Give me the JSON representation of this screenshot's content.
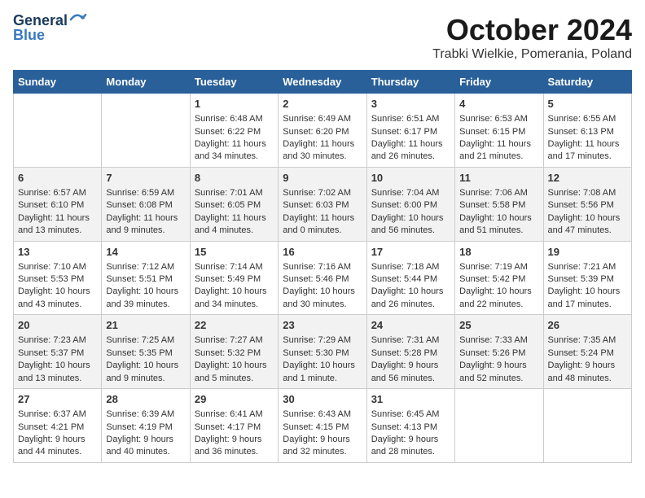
{
  "header": {
    "logo_general": "General",
    "logo_blue": "Blue",
    "title": "October 2024",
    "location": "Trabki Wielkie, Pomerania, Poland"
  },
  "weekdays": [
    "Sunday",
    "Monday",
    "Tuesday",
    "Wednesday",
    "Thursday",
    "Friday",
    "Saturday"
  ],
  "weeks": [
    [
      {
        "day": "",
        "sunrise": "",
        "sunset": "",
        "daylight": ""
      },
      {
        "day": "",
        "sunrise": "",
        "sunset": "",
        "daylight": ""
      },
      {
        "day": "1",
        "sunrise": "Sunrise: 6:48 AM",
        "sunset": "Sunset: 6:22 PM",
        "daylight": "Daylight: 11 hours and 34 minutes."
      },
      {
        "day": "2",
        "sunrise": "Sunrise: 6:49 AM",
        "sunset": "Sunset: 6:20 PM",
        "daylight": "Daylight: 11 hours and 30 minutes."
      },
      {
        "day": "3",
        "sunrise": "Sunrise: 6:51 AM",
        "sunset": "Sunset: 6:17 PM",
        "daylight": "Daylight: 11 hours and 26 minutes."
      },
      {
        "day": "4",
        "sunrise": "Sunrise: 6:53 AM",
        "sunset": "Sunset: 6:15 PM",
        "daylight": "Daylight: 11 hours and 21 minutes."
      },
      {
        "day": "5",
        "sunrise": "Sunrise: 6:55 AM",
        "sunset": "Sunset: 6:13 PM",
        "daylight": "Daylight: 11 hours and 17 minutes."
      }
    ],
    [
      {
        "day": "6",
        "sunrise": "Sunrise: 6:57 AM",
        "sunset": "Sunset: 6:10 PM",
        "daylight": "Daylight: 11 hours and 13 minutes."
      },
      {
        "day": "7",
        "sunrise": "Sunrise: 6:59 AM",
        "sunset": "Sunset: 6:08 PM",
        "daylight": "Daylight: 11 hours and 9 minutes."
      },
      {
        "day": "8",
        "sunrise": "Sunrise: 7:01 AM",
        "sunset": "Sunset: 6:05 PM",
        "daylight": "Daylight: 11 hours and 4 minutes."
      },
      {
        "day": "9",
        "sunrise": "Sunrise: 7:02 AM",
        "sunset": "Sunset: 6:03 PM",
        "daylight": "Daylight: 11 hours and 0 minutes."
      },
      {
        "day": "10",
        "sunrise": "Sunrise: 7:04 AM",
        "sunset": "Sunset: 6:00 PM",
        "daylight": "Daylight: 10 hours and 56 minutes."
      },
      {
        "day": "11",
        "sunrise": "Sunrise: 7:06 AM",
        "sunset": "Sunset: 5:58 PM",
        "daylight": "Daylight: 10 hours and 51 minutes."
      },
      {
        "day": "12",
        "sunrise": "Sunrise: 7:08 AM",
        "sunset": "Sunset: 5:56 PM",
        "daylight": "Daylight: 10 hours and 47 minutes."
      }
    ],
    [
      {
        "day": "13",
        "sunrise": "Sunrise: 7:10 AM",
        "sunset": "Sunset: 5:53 PM",
        "daylight": "Daylight: 10 hours and 43 minutes."
      },
      {
        "day": "14",
        "sunrise": "Sunrise: 7:12 AM",
        "sunset": "Sunset: 5:51 PM",
        "daylight": "Daylight: 10 hours and 39 minutes."
      },
      {
        "day": "15",
        "sunrise": "Sunrise: 7:14 AM",
        "sunset": "Sunset: 5:49 PM",
        "daylight": "Daylight: 10 hours and 34 minutes."
      },
      {
        "day": "16",
        "sunrise": "Sunrise: 7:16 AM",
        "sunset": "Sunset: 5:46 PM",
        "daylight": "Daylight: 10 hours and 30 minutes."
      },
      {
        "day": "17",
        "sunrise": "Sunrise: 7:18 AM",
        "sunset": "Sunset: 5:44 PM",
        "daylight": "Daylight: 10 hours and 26 minutes."
      },
      {
        "day": "18",
        "sunrise": "Sunrise: 7:19 AM",
        "sunset": "Sunset: 5:42 PM",
        "daylight": "Daylight: 10 hours and 22 minutes."
      },
      {
        "day": "19",
        "sunrise": "Sunrise: 7:21 AM",
        "sunset": "Sunset: 5:39 PM",
        "daylight": "Daylight: 10 hours and 17 minutes."
      }
    ],
    [
      {
        "day": "20",
        "sunrise": "Sunrise: 7:23 AM",
        "sunset": "Sunset: 5:37 PM",
        "daylight": "Daylight: 10 hours and 13 minutes."
      },
      {
        "day": "21",
        "sunrise": "Sunrise: 7:25 AM",
        "sunset": "Sunset: 5:35 PM",
        "daylight": "Daylight: 10 hours and 9 minutes."
      },
      {
        "day": "22",
        "sunrise": "Sunrise: 7:27 AM",
        "sunset": "Sunset: 5:32 PM",
        "daylight": "Daylight: 10 hours and 5 minutes."
      },
      {
        "day": "23",
        "sunrise": "Sunrise: 7:29 AM",
        "sunset": "Sunset: 5:30 PM",
        "daylight": "Daylight: 10 hours and 1 minute."
      },
      {
        "day": "24",
        "sunrise": "Sunrise: 7:31 AM",
        "sunset": "Sunset: 5:28 PM",
        "daylight": "Daylight: 9 hours and 56 minutes."
      },
      {
        "day": "25",
        "sunrise": "Sunrise: 7:33 AM",
        "sunset": "Sunset: 5:26 PM",
        "daylight": "Daylight: 9 hours and 52 minutes."
      },
      {
        "day": "26",
        "sunrise": "Sunrise: 7:35 AM",
        "sunset": "Sunset: 5:24 PM",
        "daylight": "Daylight: 9 hours and 48 minutes."
      }
    ],
    [
      {
        "day": "27",
        "sunrise": "Sunrise: 6:37 AM",
        "sunset": "Sunset: 4:21 PM",
        "daylight": "Daylight: 9 hours and 44 minutes."
      },
      {
        "day": "28",
        "sunrise": "Sunrise: 6:39 AM",
        "sunset": "Sunset: 4:19 PM",
        "daylight": "Daylight: 9 hours and 40 minutes."
      },
      {
        "day": "29",
        "sunrise": "Sunrise: 6:41 AM",
        "sunset": "Sunset: 4:17 PM",
        "daylight": "Daylight: 9 hours and 36 minutes."
      },
      {
        "day": "30",
        "sunrise": "Sunrise: 6:43 AM",
        "sunset": "Sunset: 4:15 PM",
        "daylight": "Daylight: 9 hours and 32 minutes."
      },
      {
        "day": "31",
        "sunrise": "Sunrise: 6:45 AM",
        "sunset": "Sunset: 4:13 PM",
        "daylight": "Daylight: 9 hours and 28 minutes."
      },
      {
        "day": "",
        "sunrise": "",
        "sunset": "",
        "daylight": ""
      },
      {
        "day": "",
        "sunrise": "",
        "sunset": "",
        "daylight": ""
      }
    ]
  ]
}
